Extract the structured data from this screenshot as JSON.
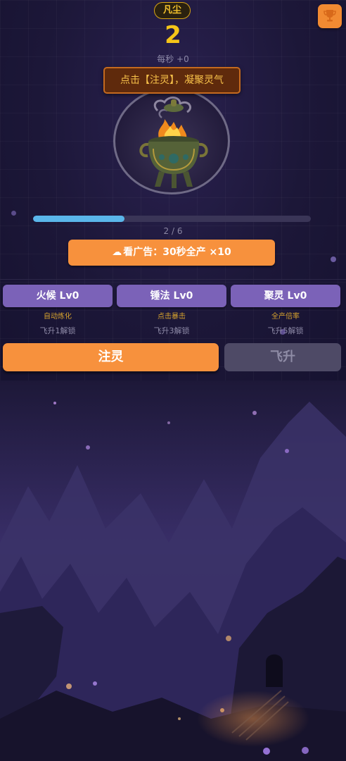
{
  "header": {
    "realm": "凡尘",
    "score": "2",
    "rate": "每秒 +0",
    "trophy_icon": "trophy-icon"
  },
  "cauldron": {
    "tip": "点击【注灵】，凝聚灵气",
    "icon": "cauldron-icon"
  },
  "progress": {
    "current": 2,
    "total": 6,
    "fraction": 0.33,
    "text": "2 / 6"
  },
  "ad_button": {
    "icon": "cloud-icon",
    "label": "看广告：30秒全产 ×10"
  },
  "upgrades": [
    {
      "label": "火候 Lv0",
      "desc": "自动炼化",
      "lock": "飞升1解锁"
    },
    {
      "label": "锤法 Lv0",
      "desc": "点击暴击",
      "lock": "飞升3解锁"
    },
    {
      "label": "聚灵 Lv0",
      "desc": "全产倍率",
      "lock": "飞升5解锁"
    }
  ],
  "actions": {
    "inject": "注灵",
    "ascend": "飞升"
  },
  "colors": {
    "accent_orange": "#f7913d",
    "upgrade_purple": "#7b62b8",
    "score_gold": "#f5c518",
    "progress_blue": "#5ab6ea",
    "disabled_gray": "#4e4a66"
  }
}
